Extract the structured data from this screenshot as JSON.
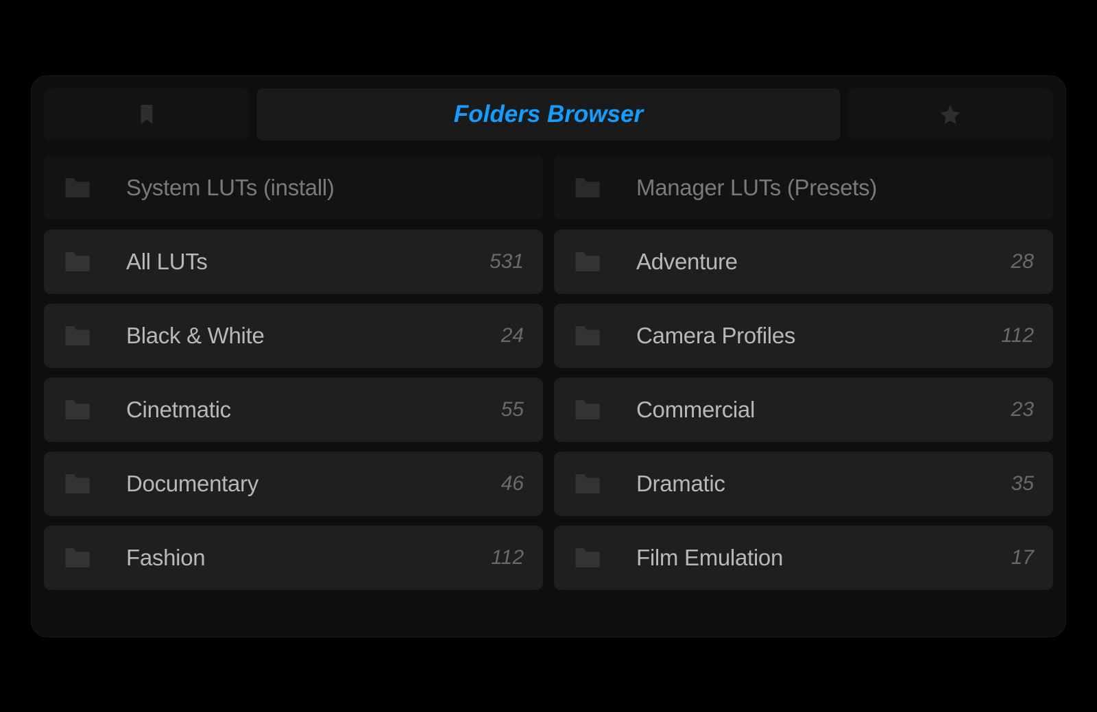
{
  "tabs": {
    "center_label": "Folders Browser"
  },
  "columns": {
    "left": {
      "header": {
        "label": "System LUTs (install)"
      },
      "items": [
        {
          "label": "All LUTs",
          "count": "531"
        },
        {
          "label": "Black & White",
          "count": "24"
        },
        {
          "label": "Cinetmatic",
          "count": "55"
        },
        {
          "label": "Documentary",
          "count": "46"
        },
        {
          "label": "Fashion",
          "count": "112"
        }
      ]
    },
    "right": {
      "header": {
        "label": "Manager LUTs (Presets)"
      },
      "items": [
        {
          "label": "Adventure",
          "count": "28"
        },
        {
          "label": "Camera Profiles",
          "count": "112"
        },
        {
          "label": "Commercial",
          "count": "23"
        },
        {
          "label": "Dramatic",
          "count": "35"
        },
        {
          "label": "Film Emulation",
          "count": "17"
        }
      ]
    }
  },
  "colors": {
    "accent": "#149dff",
    "bg_row_item": "#1f1f1f",
    "bg_row_header": "#131313",
    "text_muted": "#7a7a7a",
    "text_label": "#b8b8b8"
  }
}
